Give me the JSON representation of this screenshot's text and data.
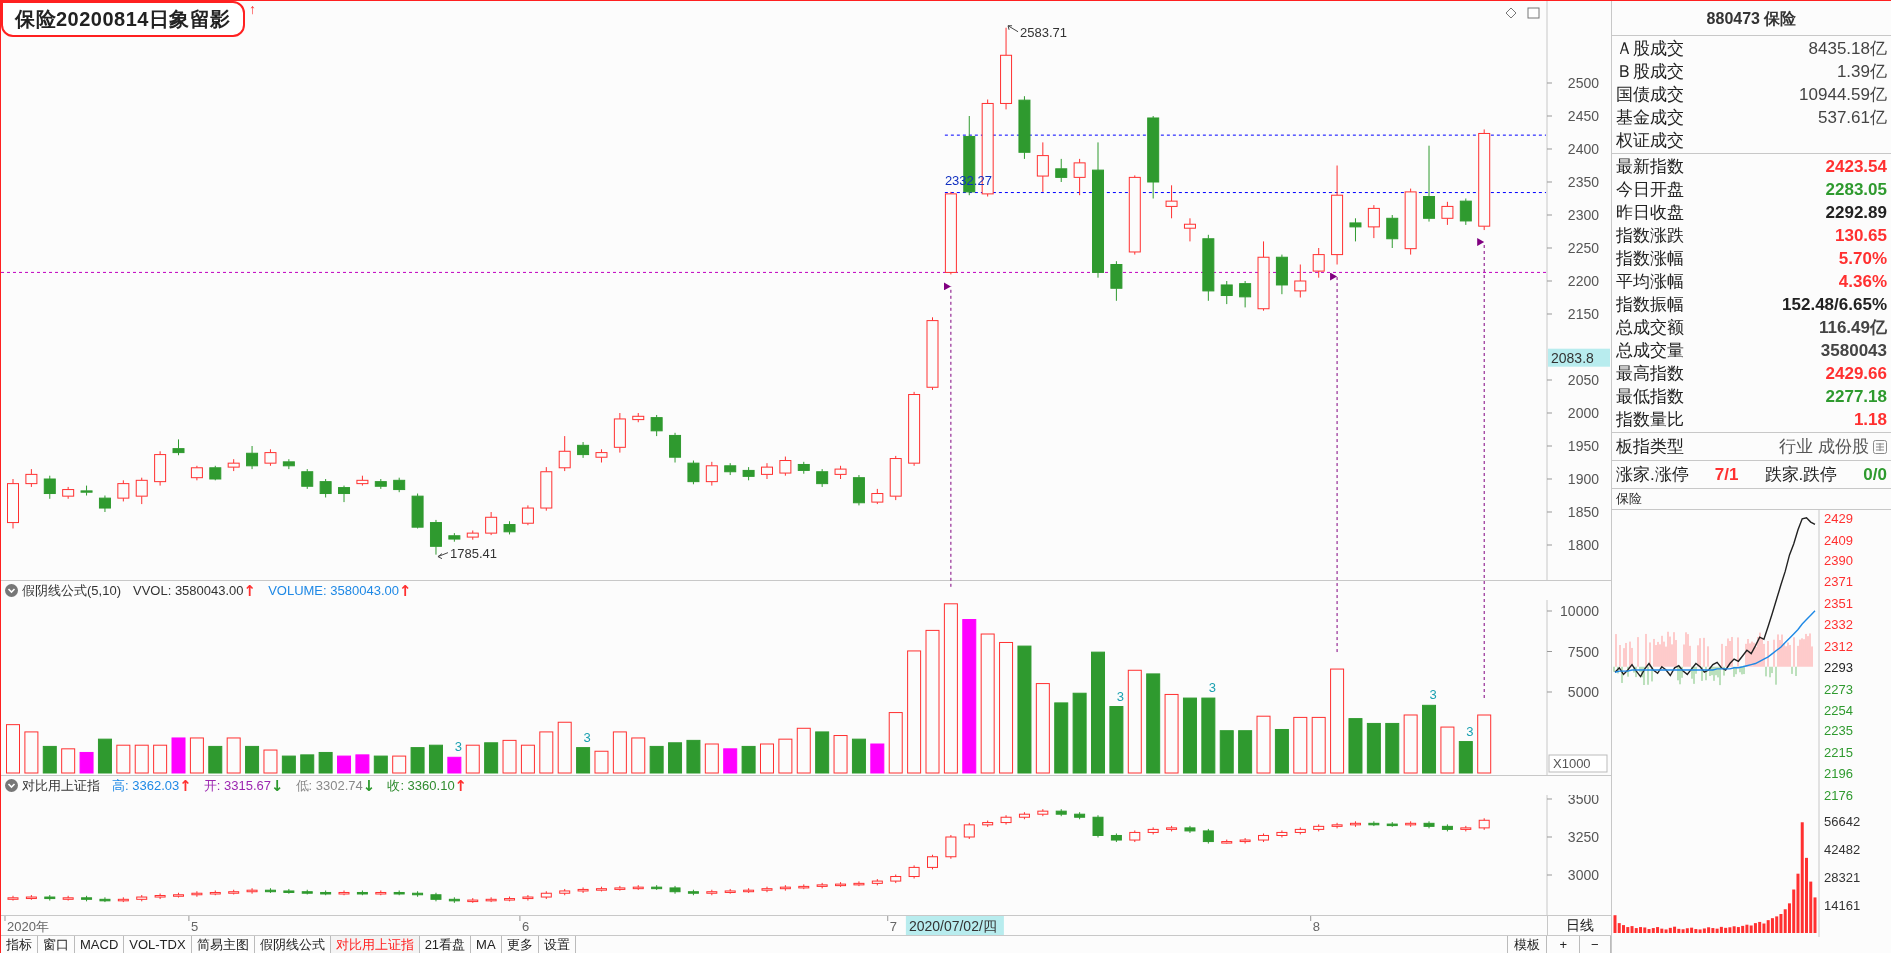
{
  "title": "保险20200814日象留影",
  "title_arrow": "↑",
  "main_chart": {
    "yticks": [
      "2500",
      "2450",
      "2400",
      "2350",
      "2300",
      "2250",
      "2200",
      "2150",
      "2050",
      "2000",
      "1950",
      "1900",
      "1850",
      "1800"
    ],
    "cursor_price": "2083.8",
    "high_note": "2583.71",
    "low_note": "1785.41",
    "level_note": "2332.27",
    "axis_labels": [
      "2020年",
      "5",
      "6",
      "7",
      "8"
    ],
    "cursor_date": "2020/07/02/四"
  },
  "volume_panel": {
    "name": "假阴线公式(5,10)",
    "values": [
      {
        "text": "VVOL: 3580043.00",
        "color": "#333333",
        "arrow": {
          "text": "↑",
          "color": "#ff3030"
        }
      },
      {
        "text": "VOLUME: 3580043.00",
        "color": "#1e88e5",
        "arrow": {
          "text": "↑",
          "color": "#ff3030"
        }
      }
    ],
    "yticks": [
      "10000",
      "7500",
      "5000"
    ],
    "unit": "X1000",
    "bar_marks": [
      "3",
      "3",
      "3",
      "3",
      "3",
      "3"
    ]
  },
  "compare_panel": {
    "name": "对比用上证指",
    "values": [
      {
        "text": "高: 3362.03",
        "color": "#1e88e5",
        "arrow": {
          "text": "↑",
          "color": "#ff3030"
        }
      },
      {
        "text": "开: 3315.67",
        "color": "#9c27b0",
        "arrow": {
          "text": "↓",
          "color": "#2e9a2e"
        }
      },
      {
        "text": "低: 3302.74",
        "color": "#888888",
        "arrow": {
          "text": "↓",
          "color": "#2e9a2e"
        }
      },
      {
        "text": "收: 3360.10",
        "color": "#2e8b2e",
        "arrow": {
          "text": "↑",
          "color": "#ff3030"
        }
      }
    ],
    "yticks": [
      "3500",
      "3250",
      "3000"
    ]
  },
  "period": "日线",
  "tabs": [
    {
      "label": "指标",
      "selected": false
    },
    {
      "label": "窗口",
      "selected": false
    },
    {
      "label": "MACD",
      "selected": false
    },
    {
      "label": "VOL-TDX",
      "selected": false
    },
    {
      "label": "简易主图",
      "selected": false
    },
    {
      "label": "假阴线公式",
      "selected": false
    },
    {
      "label": "对比用上证指",
      "selected": true
    },
    {
      "label": "21看盘",
      "selected": false
    },
    {
      "label": "MA",
      "selected": false
    },
    {
      "label": "更多",
      "selected": false
    },
    {
      "label": "设置",
      "selected": false
    }
  ],
  "template_button": "模板",
  "zoom_buttons": [
    "+",
    "−"
  ],
  "quote": {
    "header": "880473 保险",
    "turnover": [
      {
        "label": "Ａ股成交",
        "value": "8435.18亿"
      },
      {
        "label": "Ｂ股成交",
        "value": "1.39亿"
      },
      {
        "label": "国债成交",
        "value": "10944.59亿"
      },
      {
        "label": "基金成交",
        "value": "537.61亿"
      },
      {
        "label": "权证成交"
      }
    ],
    "stats": [
      {
        "label": "最新指数",
        "value": "2423.54",
        "color": "#ff3030"
      },
      {
        "label": "今日开盘",
        "value": "2283.05",
        "color": "#2e9a2e"
      },
      {
        "label": "昨日收盘",
        "value": "2292.89",
        "color": "#222222"
      },
      {
        "label": "指数涨跌",
        "value": "130.65",
        "color": "#ff3030"
      },
      {
        "label": "指数涨幅",
        "value": "5.70%",
        "color": "#ff3030"
      },
      {
        "label": "平均涨幅",
        "value": "4.36%",
        "color": "#ff3030"
      },
      {
        "label": "指数振幅",
        "value": "152.48/6.65%",
        "color": "#222222"
      },
      {
        "label": "总成交额",
        "value": "116.49亿",
        "color": "#444444"
      },
      {
        "label": "总成交量",
        "value": "3580043",
        "color": "#444444"
      },
      {
        "label": "最高指数",
        "value": "2429.66",
        "color": "#ff3030"
      },
      {
        "label": "最低指数",
        "value": "2277.18",
        "color": "#2e9a2e"
      },
      {
        "label": "指数量比",
        "value": "1.18",
        "color": "#ff3030"
      }
    ],
    "type_label": "板指类型",
    "type_value": "行业 成份股",
    "breadth": [
      {
        "label": "涨家.涨停",
        "value": "7/1",
        "color": "#ff3030"
      },
      {
        "label": "跌家.跌停",
        "value": "0/0",
        "color": "#2e9a2e"
      }
    ],
    "mini_title": "保险",
    "price_chart": {
      "chart_data": {
        "type": "line",
        "ylim": [
          2176,
          2436
        ],
        "yticks": [
          {
            "value": 2429,
            "label": "2429"
          },
          {
            "value": 2409,
            "label": "2409"
          },
          {
            "value": 2390,
            "label": "2390"
          },
          {
            "value": 2371,
            "label": "2371"
          },
          {
            "value": 2351,
            "label": "2351"
          },
          {
            "value": 2332,
            "label": "2332"
          },
          {
            "value": 2312,
            "label": "2312"
          },
          {
            "value": 2293,
            "label": "2293"
          },
          {
            "value": 2273,
            "label": "2273"
          },
          {
            "value": 2254,
            "label": "2254"
          },
          {
            "value": 2235,
            "label": "2235"
          },
          {
            "value": 2215,
            "label": "2215"
          },
          {
            "value": 2196,
            "label": "2196"
          },
          {
            "value": 2176,
            "label": "2176"
          }
        ],
        "series": [
          {
            "color": "#222222",
            "values": [
              2288,
              2292,
              2286,
              2290,
              2295,
              2289,
              2284,
              2291,
              2296,
              2290,
              2287,
              2293,
              2290,
              2285,
              2292,
              2294,
              2289,
              2286,
              2291,
              2296,
              2293,
              2288,
              2290,
              2295,
              2297,
              2292,
              2290,
              2296,
              2300,
              2298,
              2303,
              2308,
              2305,
              2312,
              2320,
              2318,
              2330,
              2342,
              2355,
              2368,
              2380,
              2395,
              2405,
              2418,
              2428,
              2429,
              2425,
              2423
            ]
          },
          {
            "color": "#1e88e5",
            "values": [
              2288,
              2289,
              2289,
              2289,
              2290,
              2290,
              2290,
              2290,
              2290,
              2290,
              2290,
              2290,
              2290,
              2290,
              2290,
              2290,
              2290,
              2290,
              2290,
              2290,
              2290,
              2290,
              2290,
              2290,
              2291,
              2291,
              2291,
              2291,
              2292,
              2292,
              2293,
              2294,
              2295,
              2296,
              2298,
              2300,
              2302,
              2305,
              2308,
              2311,
              2315,
              2319,
              2323,
              2327,
              2332,
              2336,
              2340,
              2344
            ]
          }
        ]
      }
    },
    "volume_chart": {
      "chart_data": {
        "type": "bar",
        "ylim": [
          0,
          56642
        ],
        "categories": [
          null,
          null,
          null,
          null,
          null,
          null,
          null,
          null,
          null,
          null,
          null,
          null,
          null,
          null,
          null,
          null,
          null,
          null,
          null,
          null,
          null,
          null,
          null,
          null,
          null,
          null,
          null,
          null,
          null,
          null,
          null,
          null,
          null,
          null,
          null,
          null,
          null,
          null,
          null,
          null,
          null,
          null,
          null,
          null,
          null,
          null,
          null,
          null
        ],
        "yticks": [
          {
            "value": 56642,
            "label": "56642"
          },
          {
            "value": 42482,
            "label": "42482"
          },
          {
            "value": 28321,
            "label": "28321"
          },
          {
            "value": 14161,
            "label": "14161"
          }
        ],
        "series": [
          {
            "color": "#ff3030",
            "values": [
              9000,
              5000,
              4000,
              3000,
              3500,
              2500,
              3000,
              2800,
              2000,
              2500,
              3000,
              2200,
              1800,
              2600,
              3200,
              2100,
              1900,
              2400,
              2700,
              2000,
              1800,
              2300,
              2900,
              2500,
              2200,
              3100,
              2600,
              2900,
              3400,
              3000,
              3600,
              4200,
              3800,
              5000,
              5600,
              4800,
              6500,
              7500,
              8400,
              9600,
              12000,
              15000,
              22000,
              30000,
              56000,
              38000,
              26000,
              18000
            ]
          }
        ]
      }
    }
  }
}
